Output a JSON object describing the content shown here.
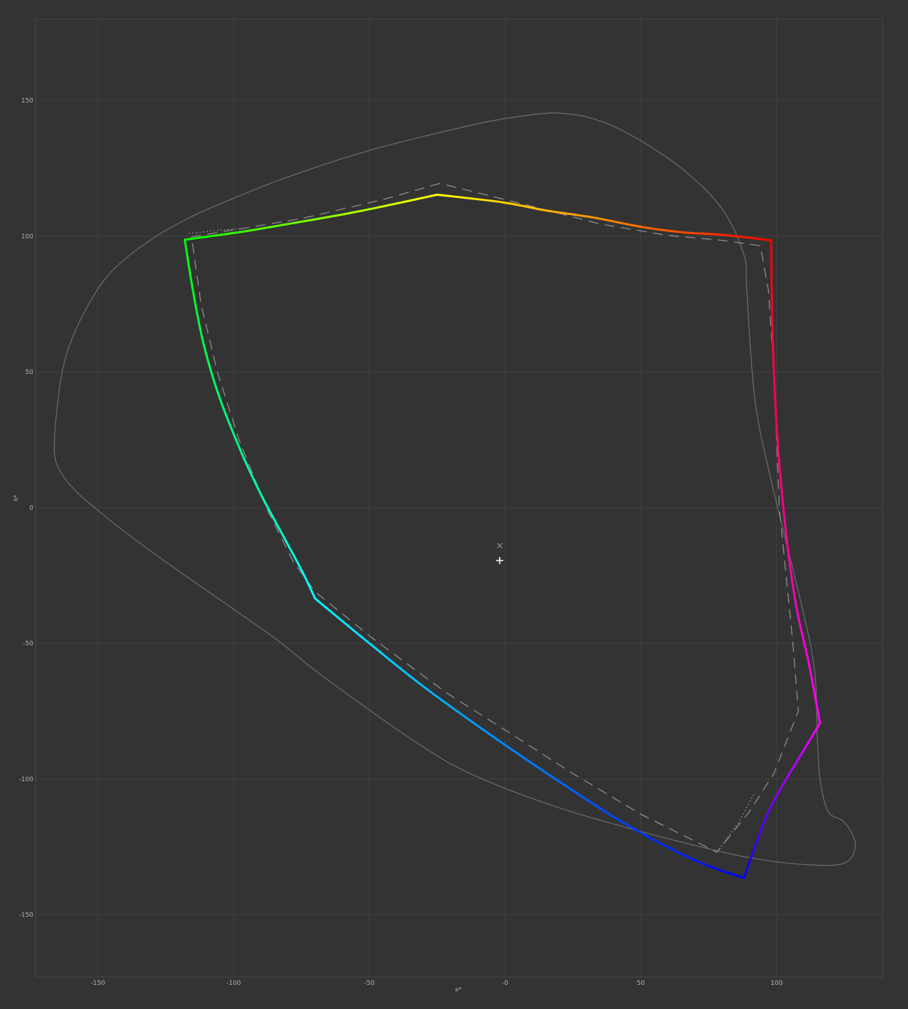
{
  "chart_data": {
    "type": "line",
    "xlabel": "a*",
    "ylabel": "b*",
    "xlim": [
      -173,
      139
    ],
    "ylim": [
      -173,
      180
    ],
    "x_ticks": [
      -150,
      -100,
      -50,
      0,
      50,
      100
    ],
    "x_tick_labels": [
      "-150",
      "-100",
      "-50",
      "-0",
      "50",
      "100"
    ],
    "y_ticks": [
      -150,
      -100,
      -50,
      0,
      50,
      100,
      150
    ],
    "y_tick_labels": [
      "-150",
      "-100",
      "-50",
      "0",
      "50",
      "100",
      "150"
    ],
    "grid": true,
    "colors": {
      "background": "#333333",
      "grid": "#424242",
      "frame": "#474747",
      "reference": "#6e6e6e",
      "dashed": "#8f8f8f"
    },
    "series": [
      {
        "style": "gradient",
        "segments": [
          {
            "points": [
              [
                98,
                98.5
              ],
              [
                80,
                100.5
              ],
              [
                65,
                101.5
              ],
              [
                50,
                103.5
              ],
              [
                32,
                107
              ],
              [
                15,
                109.5
              ],
              [
                -1,
                112.5
              ],
              [
                -25,
                115.3
              ]
            ],
            "colors": [
              "#ff0000",
              "#ff8c00",
              "#ffff00"
            ]
          },
          {
            "points": [
              [
                -25,
                115.3
              ],
              [
                -45,
                111
              ],
              [
                -60,
                108
              ],
              [
                -80,
                104.5
              ],
              [
                -96,
                101.8
              ],
              [
                -118,
                98.7
              ]
            ],
            "colors": [
              "#ffff00",
              "#00ff00"
            ]
          },
          {
            "points": [
              [
                -118,
                98.7
              ],
              [
                -115,
                80
              ],
              [
                -111,
                60
              ],
              [
                -105,
                40
              ],
              [
                -97,
                20
              ],
              [
                -90,
                5
              ],
              [
                -82,
                -10
              ],
              [
                -75,
                -23
              ],
              [
                -70,
                -33.5
              ]
            ],
            "colors": [
              "#00ff00",
              "#00ffff"
            ]
          },
          {
            "points": [
              [
                -70,
                -33.5
              ],
              [
                -50,
                -50
              ],
              [
                -30,
                -66
              ],
              [
                -5,
                -84
              ],
              [
                20,
                -101
              ],
              [
                45,
                -117
              ],
              [
                70,
                -130
              ],
              [
                88,
                -136.5
              ]
            ],
            "colors": [
              "#00ffff",
              "#0080ff",
              "#0000ff"
            ]
          },
          {
            "points": [
              [
                88,
                -136.5
              ],
              [
                92,
                -125
              ],
              [
                97,
                -112
              ],
              [
                103,
                -101
              ],
              [
                109,
                -91
              ],
              [
                116,
                -79.5
              ]
            ],
            "colors": [
              "#0000ff",
              "#ff00ff"
            ]
          },
          {
            "points": [
              [
                116,
                -79.5
              ],
              [
                112,
                -58
              ],
              [
                107,
                -35
              ],
              [
                103,
                -5
              ],
              [
                100,
                30
              ],
              [
                98.5,
                65
              ],
              [
                98,
                98.5
              ]
            ],
            "colors": [
              "#ff00ff",
              "#ff0000"
            ]
          }
        ]
      },
      {
        "style": "dashed",
        "points": [
          [
            -24,
            119.5
          ],
          [
            -45,
            113.5
          ],
          [
            -75,
            106.5
          ],
          [
            -97,
            102.8
          ],
          [
            -115.5,
            99.8
          ],
          [
            -112,
            75
          ],
          [
            -106,
            50
          ],
          [
            -98,
            25
          ],
          [
            -88,
            0
          ],
          [
            -78,
            -20
          ],
          [
            -70,
            -31
          ],
          [
            -49,
            -48
          ],
          [
            -22,
            -68
          ],
          [
            0,
            -82
          ],
          [
            25,
            -98
          ],
          [
            50,
            -113
          ],
          [
            67,
            -121.5
          ],
          [
            78,
            -127
          ],
          [
            90,
            -112
          ],
          [
            99,
            -98
          ],
          [
            108,
            -75
          ],
          [
            106,
            -50
          ],
          [
            101,
            0
          ],
          [
            99,
            50
          ],
          [
            97,
            80
          ],
          [
            94,
            96.5
          ],
          [
            80,
            98.5
          ],
          [
            60,
            100.3
          ],
          [
            35,
            104.5
          ],
          [
            10,
            111
          ],
          [
            -24,
            119.5
          ]
        ]
      },
      {
        "style": "dotted",
        "points": [
          [
            -116.5,
            101
          ],
          [
            -106,
            102.2
          ],
          [
            -97,
            102.8
          ]
        ]
      },
      {
        "style": "dotted",
        "points": [
          [
            78,
            -127
          ],
          [
            86,
            -116
          ],
          [
            92,
            -105
          ]
        ]
      },
      {
        "style": "thin",
        "points": [
          [
            18,
            145.5
          ],
          [
            10,
            144.8
          ],
          [
            -5,
            142.5
          ],
          [
            -25,
            138
          ],
          [
            -45,
            133
          ],
          [
            -65,
            127
          ],
          [
            -85,
            120
          ],
          [
            -100,
            114
          ],
          [
            -115,
            107.5
          ],
          [
            -130,
            99
          ],
          [
            -145,
            87
          ],
          [
            -155,
            72
          ],
          [
            -162,
            55
          ],
          [
            -165,
            37
          ],
          [
            -166,
            20
          ],
          [
            -163,
            12
          ],
          [
            -157,
            5
          ],
          [
            -150,
            -1
          ],
          [
            -140,
            -9
          ],
          [
            -125,
            -20
          ],
          [
            -105,
            -34
          ],
          [
            -85,
            -48
          ],
          [
            -70,
            -60
          ],
          [
            -55,
            -71
          ],
          [
            -35,
            -85
          ],
          [
            -15,
            -97
          ],
          [
            15,
            -109
          ],
          [
            45,
            -118
          ],
          [
            70,
            -124.5
          ],
          [
            90,
            -129
          ],
          [
            110,
            -131.5
          ],
          [
            125,
            -131
          ],
          [
            129,
            -124
          ],
          [
            125,
            -116
          ],
          [
            119,
            -112
          ],
          [
            116,
            -100
          ],
          [
            115,
            -85
          ],
          [
            114,
            -60
          ],
          [
            109,
            -35
          ],
          [
            98,
            10
          ],
          [
            92,
            40
          ],
          [
            89,
            80
          ],
          [
            88,
            93
          ],
          [
            80,
            110
          ],
          [
            65,
            125
          ],
          [
            45,
            138
          ],
          [
            30,
            144
          ],
          [
            18,
            145.5
          ]
        ]
      }
    ],
    "markers": [
      {
        "symbol": "x",
        "x": -2,
        "y": -14
      },
      {
        "symbol": "+",
        "x": -2,
        "y": -19.5
      }
    ]
  }
}
